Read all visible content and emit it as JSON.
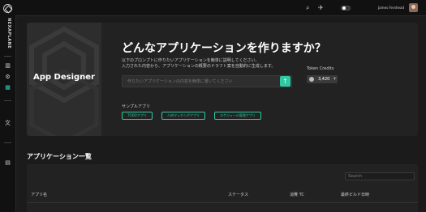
{
  "sidebar": {
    "brand": "NEXAPLANE",
    "items": [
      {
        "icon": "bar-chart-icon"
      },
      {
        "icon": "gear-icon"
      },
      {
        "icon": "grid-app-icon",
        "active": true
      },
      {
        "icon": "translate-icon"
      },
      {
        "icon": "building-icon"
      }
    ]
  },
  "topbar": {
    "username": "James Fernhead"
  },
  "hero": {
    "brand_label": "App Designer",
    "title": "どんなアプリケーションを作りますか？",
    "description_line1": "以下のプロンプトに作りたいアプリケーションを簡単に説明してください。",
    "description_line2": "入力された内容から、アプリケーションの概要のドラフト案を自動的に生成します。",
    "prompt_placeholder": "作りたいアプリケーションの内容を簡単に書いてください",
    "token_label": "Token Credits",
    "token_value": "3,420",
    "sample_label": "サンプルアプリ",
    "samples": [
      "TODOアプリ",
      "人材マッチングアプリ",
      "スケジュール管理アプリ"
    ]
  },
  "apps": {
    "title": "アプリケーション一覧",
    "search_placeholder": "Search",
    "columns": [
      "アプリ名",
      "ステータス",
      "消費 TC",
      "最終ビルド日時"
    ]
  },
  "colors": {
    "accent": "#2fc9a3",
    "background": "#1b1b1b"
  }
}
